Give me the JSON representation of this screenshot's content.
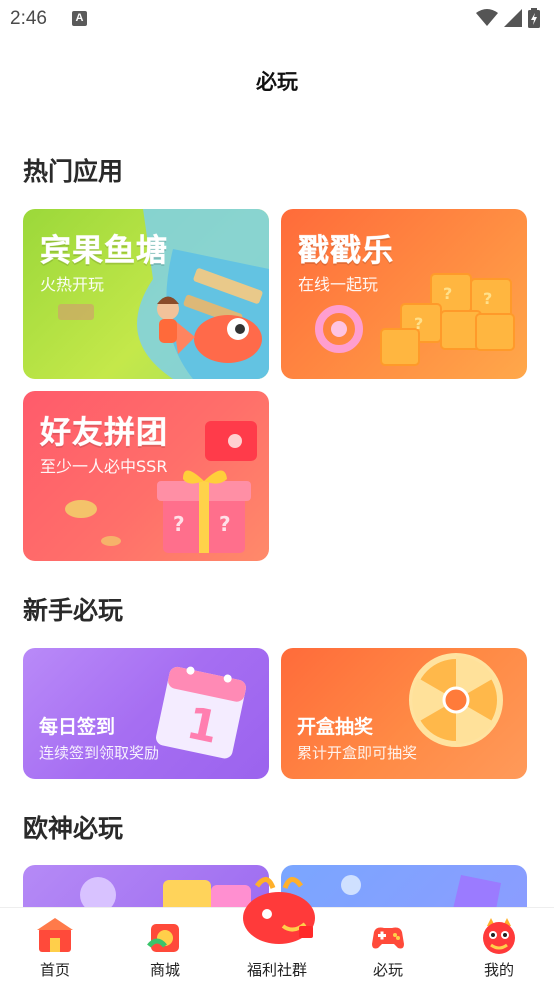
{
  "status": {
    "time": "2:46",
    "notification_letter": "A"
  },
  "page": {
    "title": "必玩"
  },
  "sections": {
    "hot": {
      "title": "热门应用"
    },
    "newbie": {
      "title": "新手必玩"
    },
    "lucky": {
      "title": "欧神必玩"
    }
  },
  "hot_cards": [
    {
      "title": "宾果鱼塘",
      "subtitle": "火热开玩"
    },
    {
      "title": "戳戳乐",
      "subtitle": "在线一起玩"
    },
    {
      "title": "好友拼团",
      "subtitle": "至少一人必中SSR"
    }
  ],
  "newbie_cards": [
    {
      "title": "每日签到",
      "subtitle": "连续签到领取奖励",
      "calendar_digit": "1"
    },
    {
      "title": "开盒抽奖",
      "subtitle": "累计开盒即可抽奖"
    }
  ],
  "tabs": [
    {
      "label": "首页",
      "icon": "home-icon"
    },
    {
      "label": "商城",
      "icon": "shop-icon"
    },
    {
      "label": "福利社群",
      "icon": "community-icon"
    },
    {
      "label": "必玩",
      "icon": "gamepad-icon"
    },
    {
      "label": "我的",
      "icon": "profile-icon"
    }
  ],
  "colors": {
    "accent": "#ff6b3d",
    "green_card": "#a6dc3c",
    "orange_card": "#ff8a3d",
    "pink_card": "#ff5a6a",
    "purple_card": "#b07cf5"
  }
}
